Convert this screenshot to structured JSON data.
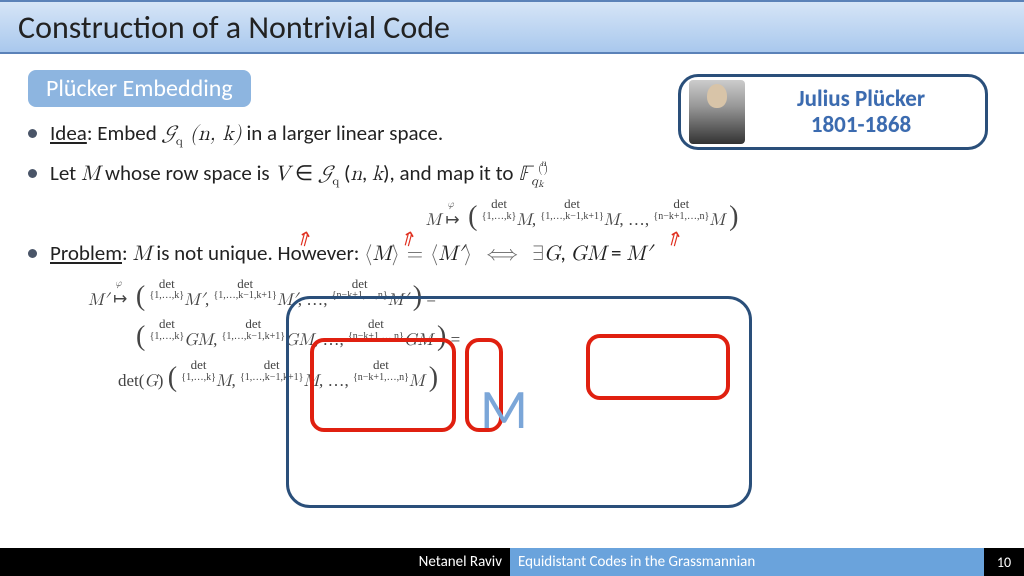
{
  "title": "Construction of a Nontrivial Code",
  "subtitle": "Plücker Embedding",
  "portrait": {
    "name": "Julius Plücker",
    "years": "1801-1868"
  },
  "bullets": {
    "b1_label": "Idea",
    "b1_rest": ": Embed ",
    "b1_math": "𝒢_q (n, k)",
    "b1_end": " in a larger linear space.",
    "b2_pre": "Let ",
    "b2_M": "M",
    "b2_mid": " whose row space is ",
    "b2_V": "V ∈ 𝒢_q (n, k)",
    "b2_map": ", and map it to ",
    "b2_F": "𝔽",
    "b3_label": "Problem",
    "b3_colon": ":  ",
    "b3_M": "M",
    "b3_mid": " is not unique.  ",
    "b3_how": "However: ",
    "b3_eq": "⟨M⟩ = ⟨M′⟩   ⟺   ∃G, GM = M′"
  },
  "eq1": "M ↦ ( det_{1,…,k} M, det_{1,…,k−1,k+1} M, …, det_{n−k+1,…,n} M )",
  "eq2a": "M′ ↦ ( det_{1,…,k} M′, det_{1,…,k−1,k+1} M′, …, det_{n−k+1,…,n} M′ ) =",
  "eq2b": "( det_{1,…,k} GM, det_{1,…,k−1,k+1} GM, …, det_{n−k+1,…,n} GM ) =",
  "eq2c": "det(G) ( det_{1,…,k} M, det_{1,…,k−1,k+1} M, …, det_{n−k+1,…,n} M )",
  "overlay_M": "M",
  "footer": {
    "author": "Netanel Raviv",
    "talk": "Equidistant Codes in the Grassmannian",
    "page": "10"
  }
}
